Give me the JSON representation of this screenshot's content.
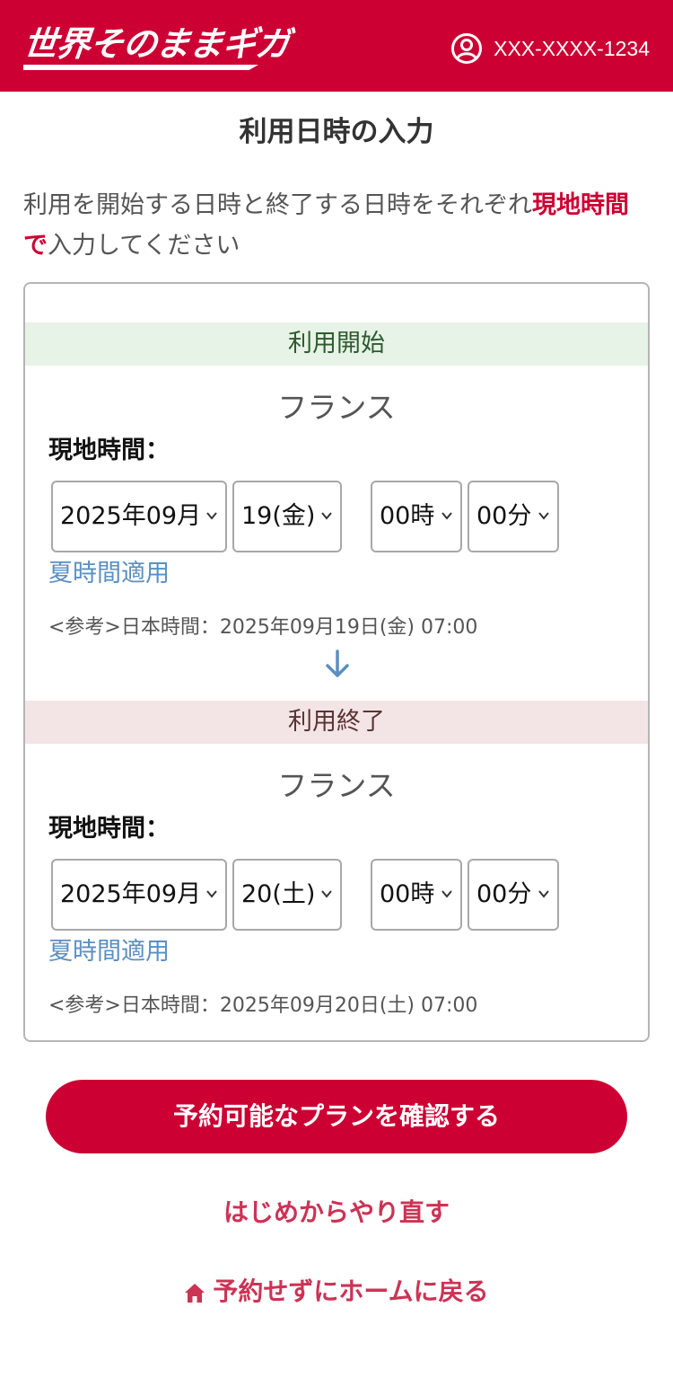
{
  "header": {
    "logo_text": "世界そのままギガ",
    "account_number": "XXX-XXXX-1234",
    "brand_color": "#cc0033"
  },
  "page": {
    "title": "利用日時の入力",
    "intro_before": "利用を開始する日時と終了する日時をそれぞれ",
    "intro_highlight": "現地時間で",
    "intro_after": "入力してください"
  },
  "start": {
    "band_label": "利用開始",
    "country": "フランス",
    "local_time_label": "現地時間：",
    "year_month": "2025年09月",
    "day": "19(金)",
    "hour": "00時",
    "minute": "00分",
    "dst_link": "夏時間適用",
    "japan_time_ref": "<参考>日本時間：2025年09月19日(金) 07:00"
  },
  "end": {
    "band_label": "利用終了",
    "country": "フランス",
    "local_time_label": "現地時間：",
    "year_month": "2025年09月",
    "day": "20(土)",
    "hour": "00時",
    "minute": "00分",
    "dst_link": "夏時間適用",
    "japan_time_ref": "<参考>日本時間：2025年09月20日(土) 07:00"
  },
  "actions": {
    "confirm_button": "予約可能なプランを確認する",
    "restart_link": "はじめからやり直す",
    "home_link": "予約せずにホームに戻る"
  },
  "icons": {
    "account": "user-circle-icon",
    "chevron": "chevron-down-icon",
    "flow": "arrow-down-icon",
    "home": "home-icon"
  }
}
